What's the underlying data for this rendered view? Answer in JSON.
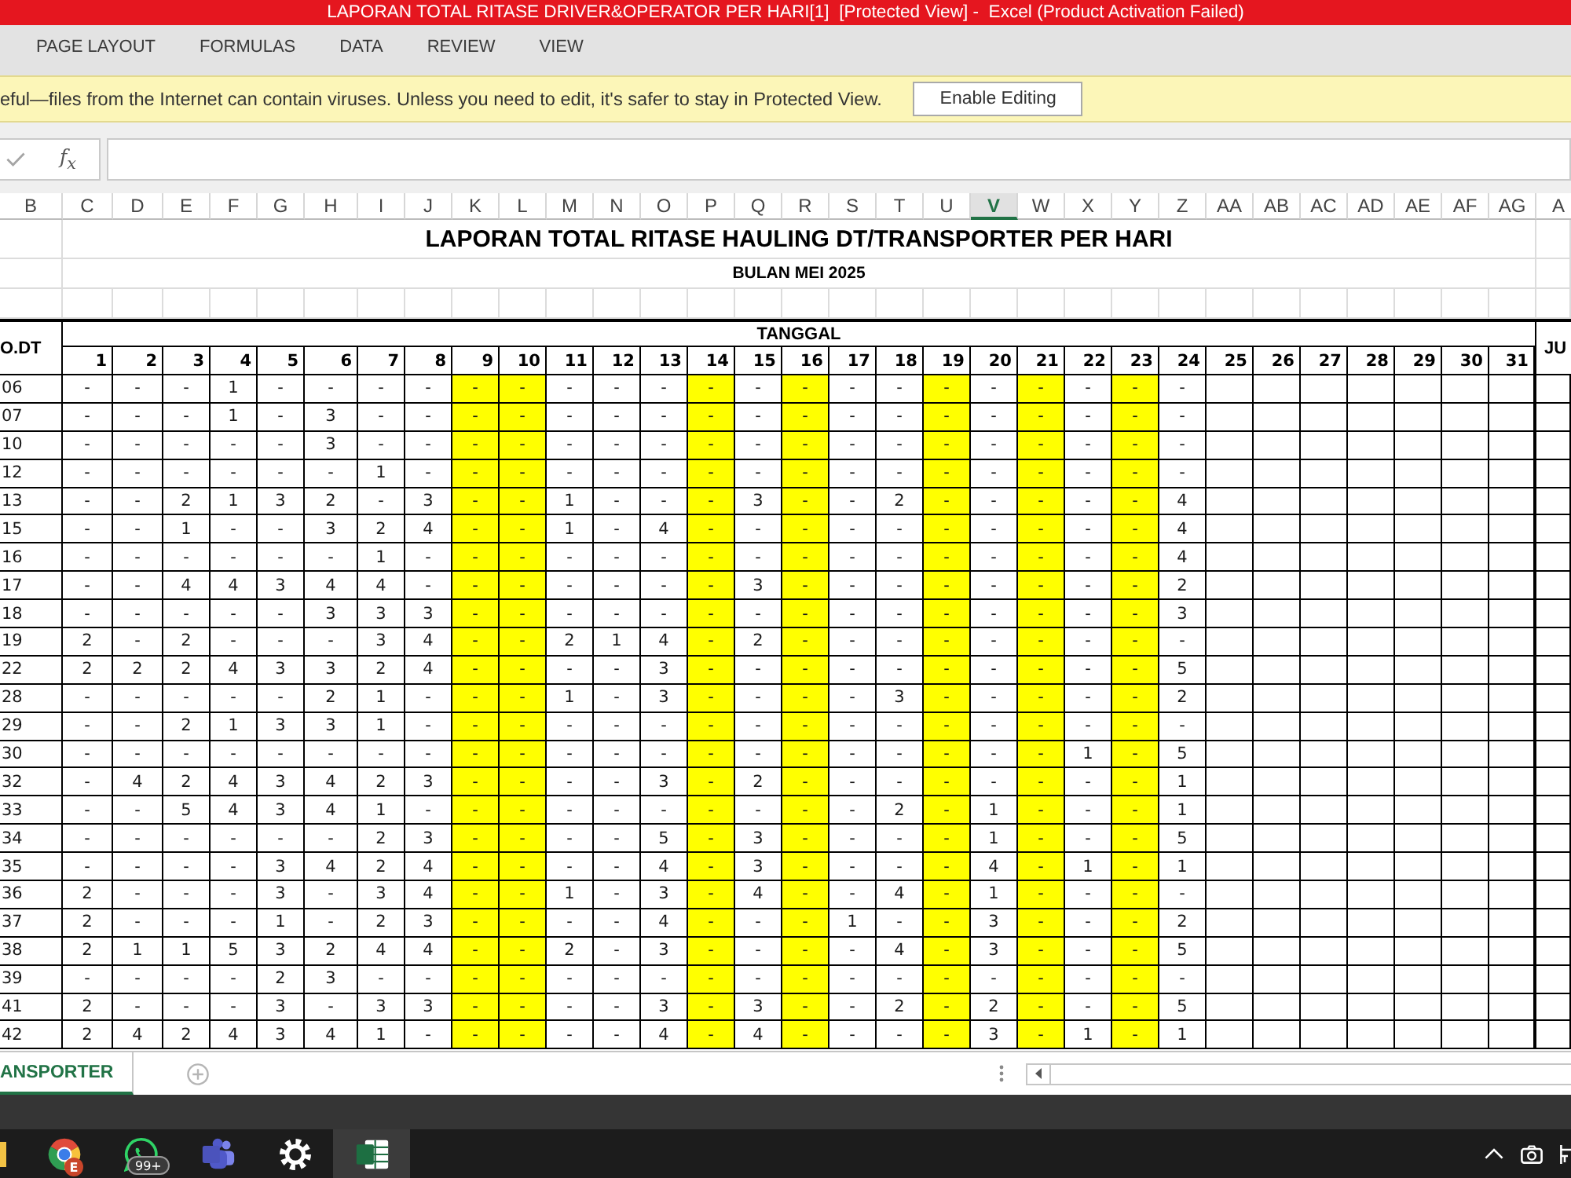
{
  "window": {
    "title": "LAPORAN TOTAL RITASE DRIVER&OPERATOR PER HARI[1]  [Protected View] -  Excel (Product Activation Failed)"
  },
  "ribbon_tabs": [
    {
      "label": "PAGE LAYOUT",
      "selected": false
    },
    {
      "label": "FORMULAS",
      "selected": false
    },
    {
      "label": "DATA",
      "selected": false
    },
    {
      "label": "REVIEW",
      "selected": false
    },
    {
      "label": "VIEW",
      "selected": false
    }
  ],
  "message_bar": {
    "text": "eful—files from the Internet can contain viruses. Unless you need to edit, it's safer to stay in Protected View.",
    "button": "Enable Editing"
  },
  "formula_bar": {
    "function_label": "f$_{x}$"
  },
  "column_headers": [
    {
      "label": "B",
      "selected": false
    },
    {
      "label": "C",
      "selected": false
    },
    {
      "label": "D",
      "selected": false
    },
    {
      "label": "E",
      "selected": false
    },
    {
      "label": "F",
      "selected": false
    },
    {
      "label": "G",
      "selected": false
    },
    {
      "label": "H",
      "selected": false
    },
    {
      "label": "I",
      "selected": false
    },
    {
      "label": "J",
      "selected": false
    },
    {
      "label": "K",
      "selected": false
    },
    {
      "label": "L",
      "selected": false
    },
    {
      "label": "M",
      "selected": false
    },
    {
      "label": "N",
      "selected": false
    },
    {
      "label": "O",
      "selected": false
    },
    {
      "label": "P",
      "selected": false
    },
    {
      "label": "Q",
      "selected": false
    },
    {
      "label": "R",
      "selected": false
    },
    {
      "label": "S",
      "selected": false
    },
    {
      "label": "T",
      "selected": false
    },
    {
      "label": "U",
      "selected": false
    },
    {
      "label": "V",
      "selected": true
    },
    {
      "label": "W",
      "selected": false
    },
    {
      "label": "X",
      "selected": false
    },
    {
      "label": "Y",
      "selected": false
    },
    {
      "label": "Z",
      "selected": false
    },
    {
      "label": "AA",
      "selected": false
    },
    {
      "label": "AB",
      "selected": false
    },
    {
      "label": "AC",
      "selected": false
    },
    {
      "label": "AD",
      "selected": false
    },
    {
      "label": "AE",
      "selected": false
    },
    {
      "label": "AF",
      "selected": false
    },
    {
      "label": "AG",
      "selected": false
    },
    {
      "label": "A",
      "selected": false
    }
  ],
  "sheet": {
    "title": "LAPORAN TOTAL RITASE HAULING DT/TRANSPORTER PER HARI",
    "subtitle": "BULAN MEI 2025",
    "unit_header": "O.DT",
    "date_header": "TANGGAL",
    "total_header": "JU",
    "days": [
      {
        "label": "1",
        "highlighted": false
      },
      {
        "label": "2",
        "highlighted": false
      },
      {
        "label": "3",
        "highlighted": false
      },
      {
        "label": "4",
        "highlighted": false
      },
      {
        "label": "5",
        "highlighted": false
      },
      {
        "label": "6",
        "highlighted": false
      },
      {
        "label": "7",
        "highlighted": false
      },
      {
        "label": "8",
        "highlighted": false
      },
      {
        "label": "9",
        "highlighted": true
      },
      {
        "label": "10",
        "highlighted": true
      },
      {
        "label": "11",
        "highlighted": false
      },
      {
        "label": "12",
        "highlighted": false
      },
      {
        "label": "13",
        "highlighted": false
      },
      {
        "label": "14",
        "highlighted": true
      },
      {
        "label": "15",
        "highlighted": false
      },
      {
        "label": "16",
        "highlighted": true
      },
      {
        "label": "17",
        "highlighted": false
      },
      {
        "label": "18",
        "highlighted": false
      },
      {
        "label": "19",
        "highlighted": true
      },
      {
        "label": "20",
        "highlighted": false
      },
      {
        "label": "21",
        "highlighted": true
      },
      {
        "label": "22",
        "highlighted": false
      },
      {
        "label": "23",
        "highlighted": true
      },
      {
        "label": "24",
        "highlighted": false
      },
      {
        "label": "25",
        "highlighted": false
      },
      {
        "label": "26",
        "highlighted": false
      },
      {
        "label": "27",
        "highlighted": false
      },
      {
        "label": "28",
        "highlighted": false
      },
      {
        "label": "29",
        "highlighted": false
      },
      {
        "label": "30",
        "highlighted": false
      },
      {
        "label": "31",
        "highlighted": false
      }
    ],
    "rows": [
      {
        "unit": "06",
        "values": [
          "-",
          "-",
          "-",
          "1",
          "-",
          "-",
          "-",
          "-",
          "-",
          "-",
          "-",
          "-",
          "-",
          "-",
          "-",
          "-",
          "-",
          "-",
          "-",
          "-",
          "-",
          "-",
          "-",
          "-"
        ]
      },
      {
        "unit": "07",
        "values": [
          "-",
          "-",
          "-",
          "1",
          "-",
          "3",
          "-",
          "-",
          "-",
          "-",
          "-",
          "-",
          "-",
          "-",
          "-",
          "-",
          "-",
          "-",
          "-",
          "-",
          "-",
          "-",
          "-",
          "-"
        ]
      },
      {
        "unit": "10",
        "values": [
          "-",
          "-",
          "-",
          "-",
          "-",
          "3",
          "-",
          "-",
          "-",
          "-",
          "-",
          "-",
          "-",
          "-",
          "-",
          "-",
          "-",
          "-",
          "-",
          "-",
          "-",
          "-",
          "-",
          "-"
        ]
      },
      {
        "unit": "12",
        "values": [
          "-",
          "-",
          "-",
          "-",
          "-",
          "-",
          "1",
          "-",
          "-",
          "-",
          "-",
          "-",
          "-",
          "-",
          "-",
          "-",
          "-",
          "-",
          "-",
          "-",
          "-",
          "-",
          "-",
          "-"
        ]
      },
      {
        "unit": "13",
        "values": [
          "-",
          "-",
          "2",
          "1",
          "3",
          "2",
          "-",
          "3",
          "-",
          "-",
          "1",
          "-",
          "-",
          "-",
          "3",
          "-",
          "-",
          "2",
          "-",
          "-",
          "-",
          "-",
          "-",
          "4"
        ]
      },
      {
        "unit": "15",
        "values": [
          "-",
          "-",
          "1",
          "-",
          "-",
          "3",
          "2",
          "4",
          "-",
          "-",
          "1",
          "-",
          "4",
          "-",
          "-",
          "-",
          "-",
          "-",
          "-",
          "-",
          "-",
          "-",
          "-",
          "4"
        ]
      },
      {
        "unit": "16",
        "values": [
          "-",
          "-",
          "-",
          "-",
          "-",
          "-",
          "1",
          "-",
          "-",
          "-",
          "-",
          "-",
          "-",
          "-",
          "-",
          "-",
          "-",
          "-",
          "-",
          "-",
          "-",
          "-",
          "-",
          "4"
        ]
      },
      {
        "unit": "17",
        "values": [
          "-",
          "-",
          "4",
          "4",
          "3",
          "4",
          "4",
          "-",
          "-",
          "-",
          "-",
          "-",
          "-",
          "-",
          "3",
          "-",
          "-",
          "-",
          "-",
          "-",
          "-",
          "-",
          "-",
          "2"
        ]
      },
      {
        "unit": "18",
        "values": [
          "-",
          "-",
          "-",
          "-",
          "-",
          "3",
          "3",
          "3",
          "-",
          "-",
          "-",
          "-",
          "-",
          "-",
          "-",
          "-",
          "-",
          "-",
          "-",
          "-",
          "-",
          "-",
          "-",
          "3"
        ]
      },
      {
        "unit": "19",
        "values": [
          "2",
          "-",
          "2",
          "-",
          "-",
          "-",
          "3",
          "4",
          "-",
          "-",
          "2",
          "1",
          "4",
          "-",
          "2",
          "-",
          "-",
          "-",
          "-",
          "-",
          "-",
          "-",
          "-",
          "-"
        ]
      },
      {
        "unit": "22",
        "values": [
          "2",
          "2",
          "2",
          "4",
          "3",
          "3",
          "2",
          "4",
          "-",
          "-",
          "-",
          "-",
          "3",
          "-",
          "-",
          "-",
          "-",
          "-",
          "-",
          "-",
          "-",
          "-",
          "-",
          "5"
        ]
      },
      {
        "unit": "28",
        "values": [
          "-",
          "-",
          "-",
          "-",
          "-",
          "2",
          "1",
          "-",
          "-",
          "-",
          "1",
          "-",
          "3",
          "-",
          "-",
          "-",
          "-",
          "3",
          "-",
          "-",
          "-",
          "-",
          "-",
          "2"
        ]
      },
      {
        "unit": "29",
        "values": [
          "-",
          "-",
          "2",
          "1",
          "3",
          "3",
          "1",
          "-",
          "-",
          "-",
          "-",
          "-",
          "-",
          "-",
          "-",
          "-",
          "-",
          "-",
          "-",
          "-",
          "-",
          "-",
          "-",
          "-"
        ]
      },
      {
        "unit": "30",
        "values": [
          "-",
          "-",
          "-",
          "-",
          "-",
          "-",
          "-",
          "-",
          "-",
          "-",
          "-",
          "-",
          "-",
          "-",
          "-",
          "-",
          "-",
          "-",
          "-",
          "-",
          "-",
          "1",
          "-",
          "5"
        ]
      },
      {
        "unit": "32",
        "values": [
          "-",
          "4",
          "2",
          "4",
          "3",
          "4",
          "2",
          "3",
          "-",
          "-",
          "-",
          "-",
          "3",
          "-",
          "2",
          "-",
          "-",
          "-",
          "-",
          "-",
          "-",
          "-",
          "-",
          "1"
        ]
      },
      {
        "unit": "33",
        "values": [
          "-",
          "-",
          "5",
          "4",
          "3",
          "4",
          "1",
          "-",
          "-",
          "-",
          "-",
          "-",
          "-",
          "-",
          "-",
          "-",
          "-",
          "2",
          "-",
          "1",
          "-",
          "-",
          "-",
          "1"
        ]
      },
      {
        "unit": "34",
        "values": [
          "-",
          "-",
          "-",
          "-",
          "-",
          "-",
          "2",
          "3",
          "-",
          "-",
          "-",
          "-",
          "5",
          "-",
          "3",
          "-",
          "-",
          "-",
          "-",
          "1",
          "-",
          "-",
          "-",
          "5"
        ]
      },
      {
        "unit": "35",
        "values": [
          "-",
          "-",
          "-",
          "-",
          "3",
          "4",
          "2",
          "4",
          "-",
          "-",
          "-",
          "-",
          "4",
          "-",
          "3",
          "-",
          "-",
          "-",
          "-",
          "4",
          "-",
          "1",
          "-",
          "1"
        ]
      },
      {
        "unit": "36",
        "values": [
          "2",
          "-",
          "-",
          "-",
          "3",
          "-",
          "3",
          "4",
          "-",
          "-",
          "1",
          "-",
          "3",
          "-",
          "4",
          "-",
          "-",
          "4",
          "-",
          "1",
          "-",
          "-",
          "-",
          "-"
        ]
      },
      {
        "unit": "37",
        "values": [
          "2",
          "-",
          "-",
          "-",
          "1",
          "-",
          "2",
          "3",
          "-",
          "-",
          "-",
          "-",
          "4",
          "-",
          "-",
          "-",
          "1",
          "-",
          "-",
          "3",
          "-",
          "-",
          "-",
          "2"
        ]
      },
      {
        "unit": "38",
        "values": [
          "2",
          "1",
          "1",
          "5",
          "3",
          "2",
          "4",
          "4",
          "-",
          "-",
          "2",
          "-",
          "3",
          "-",
          "-",
          "-",
          "-",
          "4",
          "-",
          "3",
          "-",
          "-",
          "-",
          "5"
        ]
      },
      {
        "unit": "39",
        "values": [
          "-",
          "-",
          "-",
          "-",
          "2",
          "3",
          "-",
          "-",
          "-",
          "-",
          "-",
          "-",
          "-",
          "-",
          "-",
          "-",
          "-",
          "-",
          "-",
          "-",
          "-",
          "-",
          "-",
          "-"
        ]
      },
      {
        "unit": "41",
        "values": [
          "2",
          "-",
          "-",
          "-",
          "3",
          "-",
          "3",
          "3",
          "-",
          "-",
          "-",
          "-",
          "3",
          "-",
          "3",
          "-",
          "-",
          "2",
          "-",
          "2",
          "-",
          "-",
          "-",
          "5"
        ]
      },
      {
        "unit": "42",
        "values": [
          "2",
          "4",
          "2",
          "4",
          "3",
          "4",
          "1",
          "-",
          "-",
          "-",
          "-",
          "-",
          "4",
          "-",
          "4",
          "-",
          "-",
          "-",
          "-",
          "3",
          "-",
          "1",
          "-",
          "1"
        ]
      }
    ]
  },
  "sheet_tabs": [
    {
      "label": "ANSPORTER",
      "selected": true
    }
  ],
  "taskbar": {
    "apps": [
      {
        "kind": "folder",
        "active": false
      },
      {
        "kind": "browser",
        "active": false,
        "badge": {
          "kind": "initial",
          "text": "E"
        }
      },
      {
        "kind": "chat",
        "active": false,
        "badge": {
          "kind": "count",
          "text": "99+"
        }
      },
      {
        "kind": "team",
        "active": false
      },
      {
        "kind": "settings",
        "active": false
      },
      {
        "kind": "spreadsheet",
        "active": true
      }
    ],
    "tray": [
      {
        "kind": "chevron"
      },
      {
        "kind": "camera"
      },
      {
        "kind": "network"
      }
    ]
  }
}
